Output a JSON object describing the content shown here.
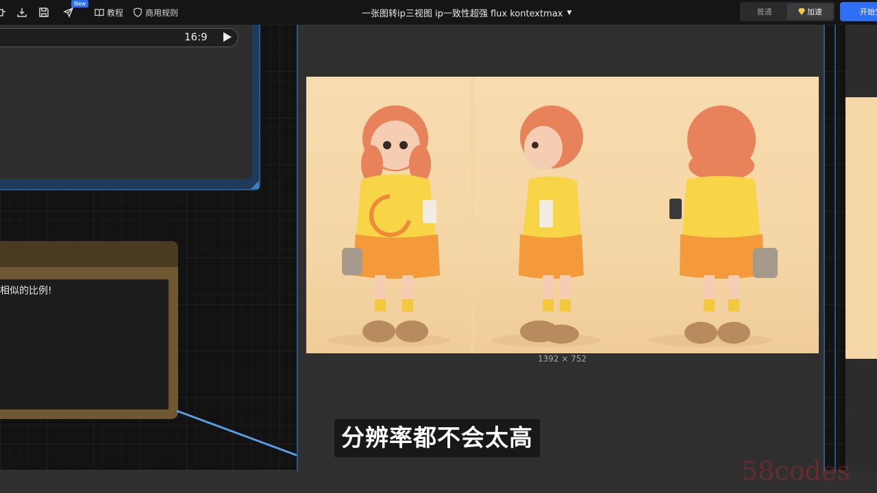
{
  "toolbar": {
    "new_badge": "New",
    "tutorial_label": "教程",
    "rules_label": "商用规则",
    "title": "一张图转ip三视图 ip一致性超强 flux kontextmax",
    "mode_normal": "普通",
    "mode_fast": "加速",
    "start_label": "开始生"
  },
  "nodes": {
    "aspect": {
      "ratio_value": "16:9"
    },
    "note": {
      "text": "相似的比例!"
    },
    "preview": {
      "dimensions": "1392 × 752"
    }
  },
  "subtitle": "分辨率都不会太高",
  "watermark": "58codes",
  "colors": {
    "accent_blue": "#2f6ff5",
    "node_border": "#2b5a8a",
    "note_brown": "#6e5832",
    "wire": "#5aa0e6"
  }
}
